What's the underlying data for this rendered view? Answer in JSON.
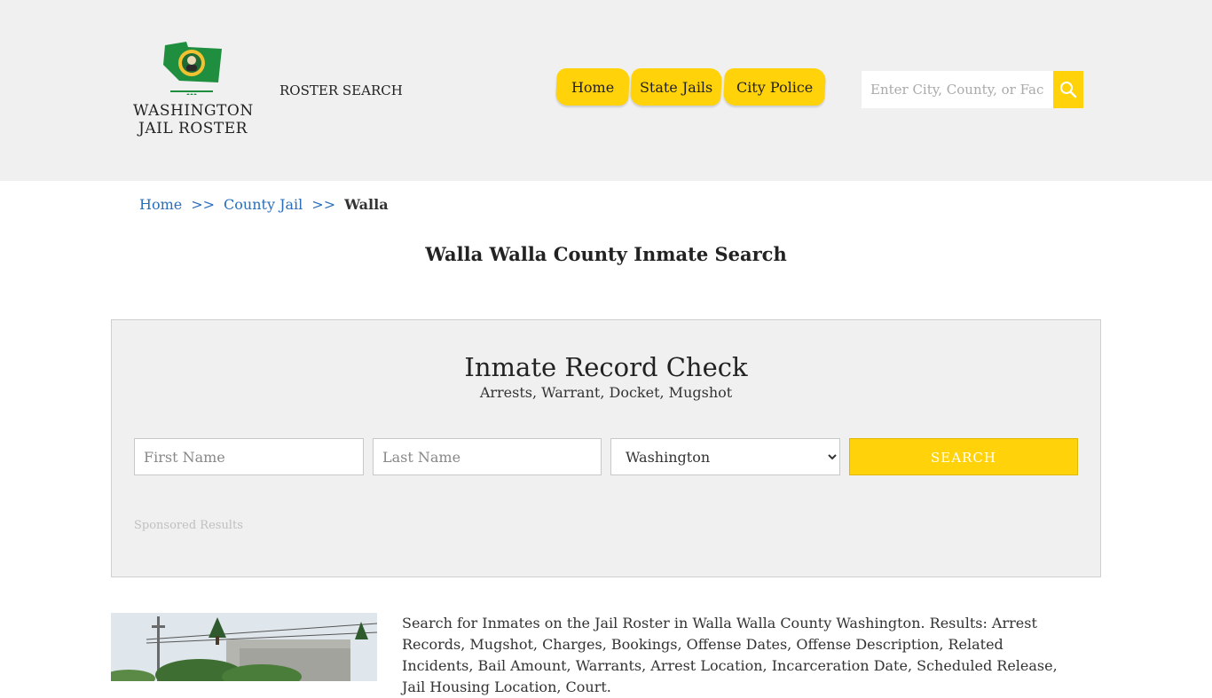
{
  "brand": {
    "line1": "WASHINGTON",
    "line2": "JAIL ROSTER",
    "flag_color": "#1f8f3f"
  },
  "header": {
    "roster_search": "ROSTER SEARCH",
    "nav": [
      {
        "label": "Home"
      },
      {
        "label": "State Jails"
      },
      {
        "label": "City Police"
      }
    ],
    "search_placeholder": "Enter City, County, or Facility",
    "accent_color": "#ffd20a"
  },
  "breadcrumb": {
    "items": [
      "Home",
      "County Jail"
    ],
    "separator": ">>",
    "current": "Walla"
  },
  "page_title": "Walla Walla County Inmate Search",
  "record_check": {
    "title": "Inmate Record Check",
    "subtitle": "Arrests, Warrant, Docket, Mugshot",
    "first_name_placeholder": "First Name",
    "last_name_placeholder": "Last Name",
    "state_selected": "Washington",
    "search_label": "SEARCH",
    "sponsored": "Sponsored Results"
  },
  "description": "Search for Inmates on the Jail Roster in Walla Walla County Washington. Results: Arrest Records, Mugshot, Charges, Bookings, Offense Dates, Offense Description, Related Incidents, Bail Amount, Warrants, Arrest Location, Incarceration Date, Scheduled Release, Jail Housing Location, Court."
}
